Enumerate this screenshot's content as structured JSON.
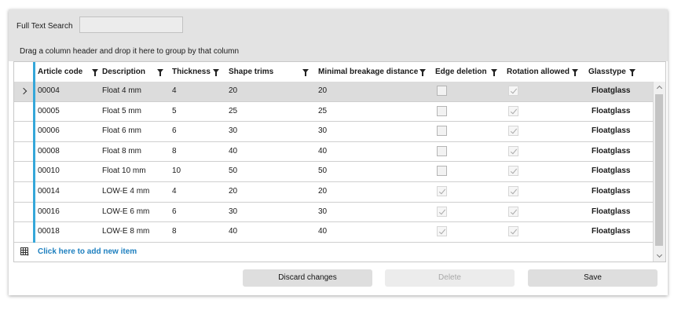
{
  "search": {
    "label": "Full Text Search",
    "value": "",
    "placeholder": ""
  },
  "group_hint": "Drag a column header and drop it here to group by that column",
  "columns": [
    {
      "label": "Article code"
    },
    {
      "label": "Description"
    },
    {
      "label": "Thickness"
    },
    {
      "label": "Shape trims"
    },
    {
      "label": "Minimal breakage distance"
    },
    {
      "label": "Edge deletion"
    },
    {
      "label": "Rotation allowed"
    },
    {
      "label": "Glasstype"
    }
  ],
  "rows": [
    {
      "code": "00004",
      "description": "Float 4 mm",
      "thickness": "4",
      "shape_trims": "20",
      "breakage": "20",
      "edge_deletion": false,
      "rotation_allowed": true,
      "glasstype": "Floatglass",
      "selected": true
    },
    {
      "code": "00005",
      "description": "Float 5 mm",
      "thickness": "5",
      "shape_trims": "25",
      "breakage": "25",
      "edge_deletion": false,
      "rotation_allowed": true,
      "glasstype": "Floatglass"
    },
    {
      "code": "00006",
      "description": "Float 6 mm",
      "thickness": "6",
      "shape_trims": "30",
      "breakage": "30",
      "edge_deletion": false,
      "rotation_allowed": true,
      "glasstype": "Floatglass"
    },
    {
      "code": "00008",
      "description": "Float 8 mm",
      "thickness": "8",
      "shape_trims": "40",
      "breakage": "40",
      "edge_deletion": false,
      "rotation_allowed": true,
      "glasstype": "Floatglass"
    },
    {
      "code": "00010",
      "description": "Float 10 mm",
      "thickness": "10",
      "shape_trims": "50",
      "breakage": "50",
      "edge_deletion": false,
      "rotation_allowed": true,
      "glasstype": "Floatglass"
    },
    {
      "code": "00014",
      "description": "LOW-E 4 mm",
      "thickness": "4",
      "shape_trims": "20",
      "breakage": "20",
      "edge_deletion": true,
      "rotation_allowed": true,
      "glasstype": "Floatglass"
    },
    {
      "code": "00016",
      "description": "LOW-E 6 mm",
      "thickness": "6",
      "shape_trims": "30",
      "breakage": "30",
      "edge_deletion": true,
      "rotation_allowed": true,
      "glasstype": "Floatglass"
    },
    {
      "code": "00018",
      "description": "LOW-E 8 mm",
      "thickness": "8",
      "shape_trims": "40",
      "breakage": "40",
      "edge_deletion": true,
      "rotation_allowed": true,
      "glasstype": "Floatglass"
    }
  ],
  "new_item_label": "Click here to add new item",
  "icons": {
    "filter": "filter-icon",
    "row_indicator": "chevron-right-icon",
    "add_row": "grid-icon"
  },
  "buttons": {
    "discard": "Discard changes",
    "delete": "Delete",
    "save": "Save"
  },
  "colors": {
    "accent": "#35a7d9",
    "link": "#1d7fbf",
    "selected_row": "#dcdcdc"
  }
}
